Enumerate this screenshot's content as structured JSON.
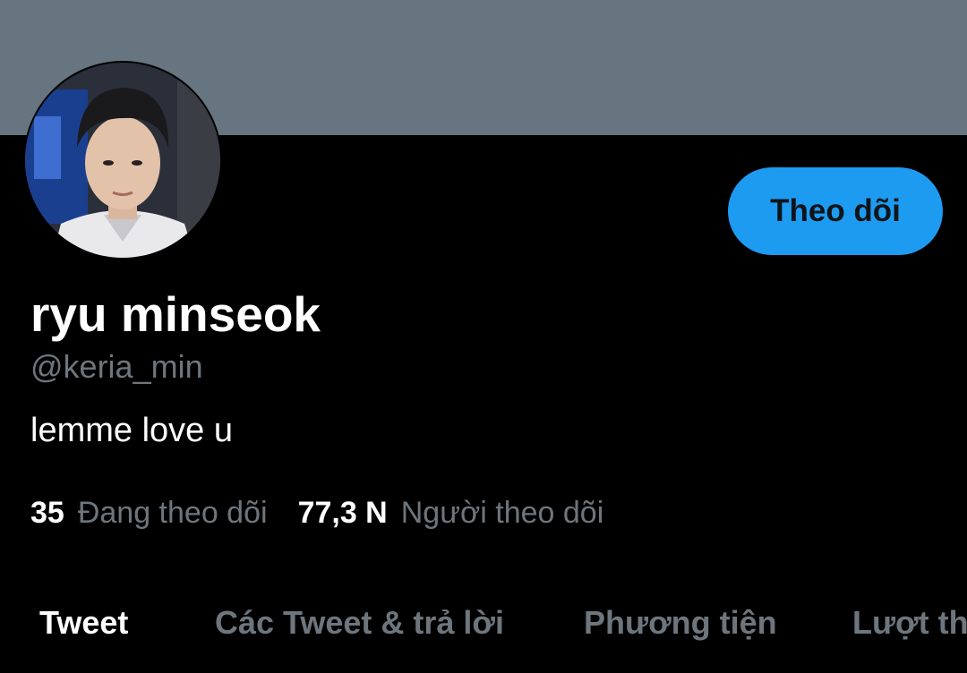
{
  "profile": {
    "display_name": "ryu minseok",
    "handle": "@keria_min",
    "bio": "lemme love u",
    "follow_label": "Theo dõi"
  },
  "stats": {
    "following_count": "35",
    "following_label": "Đang theo dõi",
    "followers_count": "77,3 N",
    "followers_label": "Người theo dõi"
  },
  "tabs": [
    {
      "label": "Tweet",
      "active": true
    },
    {
      "label": "Các Tweet & trả lời",
      "active": false
    },
    {
      "label": "Phương tiện",
      "active": false
    },
    {
      "label": "Lượt thích",
      "active": false
    }
  ],
  "colors": {
    "background": "#000000",
    "banner": "#66757f",
    "accent": "#1d9bf0",
    "primary_text": "#ffffff",
    "secondary_text": "#6e767d"
  }
}
